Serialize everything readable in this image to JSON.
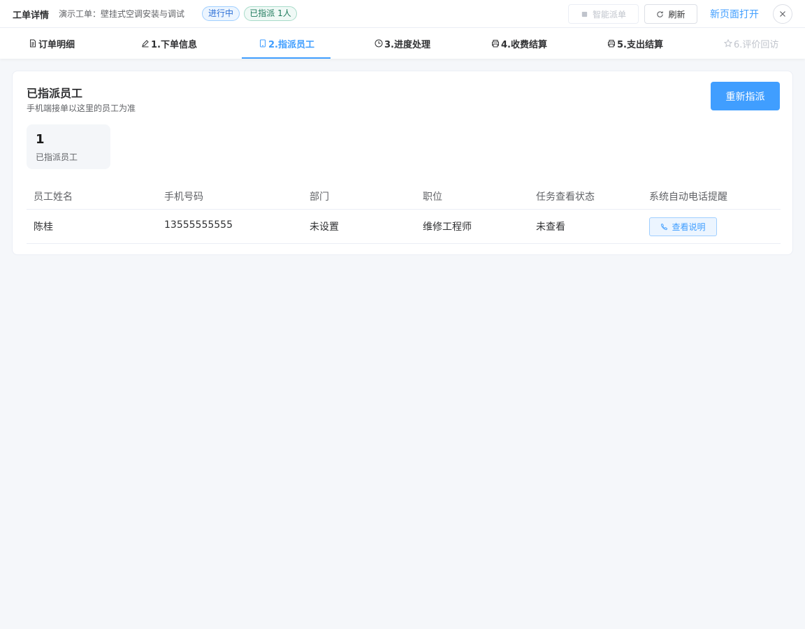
{
  "header": {
    "title": "工单详情",
    "subtitle": "演示工单：壁挂式空调安装与调试",
    "status_badge": "进行中",
    "assigned_badge": "已指派 1人",
    "smart_dispatch_label": "智能派单",
    "refresh_label": "刷新",
    "open_new_page_label": "新页面打开"
  },
  "tabs": [
    {
      "label": "订单明细",
      "icon": "document-icon"
    },
    {
      "label": "1.下单信息",
      "icon": "pen-icon"
    },
    {
      "label": "2.指派员工",
      "icon": "tablet-icon"
    },
    {
      "label": "3.进度处理",
      "icon": "clock-icon"
    },
    {
      "label": "4.收费结算",
      "icon": "printer-icon"
    },
    {
      "label": "5.支出结算",
      "icon": "printer-icon"
    },
    {
      "label": "6.评价回访",
      "icon": "star-icon"
    }
  ],
  "active_tab": "2.指派员工",
  "card": {
    "title": "已指派员工",
    "description": "手机端接单以这里的员工为准",
    "reassign_label": "重新指派",
    "stat_value": "1",
    "stat_label": "已指派员工"
  },
  "table": {
    "headers": [
      "员工姓名",
      "手机号码",
      "部门",
      "职位",
      "任务查看状态",
      "系统自动电话提醒"
    ],
    "rows": [
      {
        "name": "陈桂",
        "phone": "13555555555",
        "department": "未设置",
        "position": "维修工程师",
        "view_status": "未查看",
        "action_label": "查看说明"
      }
    ]
  },
  "colors": {
    "accent": "#409eff",
    "background": "#f5f7fa",
    "status_blue_bg": "#ecf5ff",
    "status_green_bg": "#f0f9f6"
  }
}
